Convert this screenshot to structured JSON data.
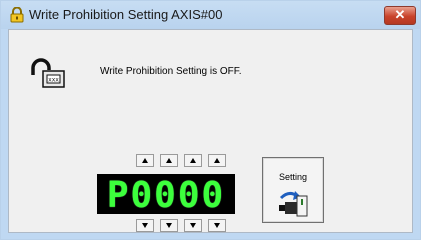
{
  "window": {
    "title": "Write Prohibition Setting AXIS#00",
    "close_label": "✕"
  },
  "status": {
    "message": "Write Prohibition Setting is OFF."
  },
  "display": {
    "value": "P0000"
  },
  "setting_button": {
    "label": "Setting"
  },
  "colors": {
    "segment_green": "#3cff3c",
    "display_bg": "#000000",
    "close_red": "#c9432b"
  }
}
